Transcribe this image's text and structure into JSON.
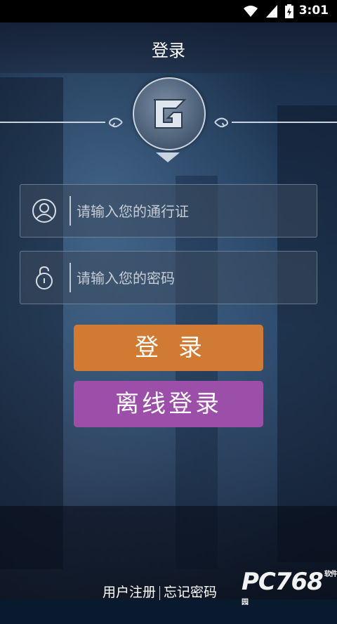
{
  "status_bar": {
    "time": "3:01"
  },
  "header": {
    "title": "登录"
  },
  "form": {
    "username_placeholder": "请输入您的通行证",
    "password_placeholder": "请输入您的密码"
  },
  "buttons": {
    "login": "登录",
    "offline_login": "离线登录"
  },
  "footer": {
    "register": "用户注册",
    "forgot_password": "忘记密码"
  },
  "watermark": {
    "main": "PC768",
    "sub": "软件园"
  },
  "colors": {
    "login_button": "#d07a33",
    "offline_button": "#9c4fa8"
  }
}
